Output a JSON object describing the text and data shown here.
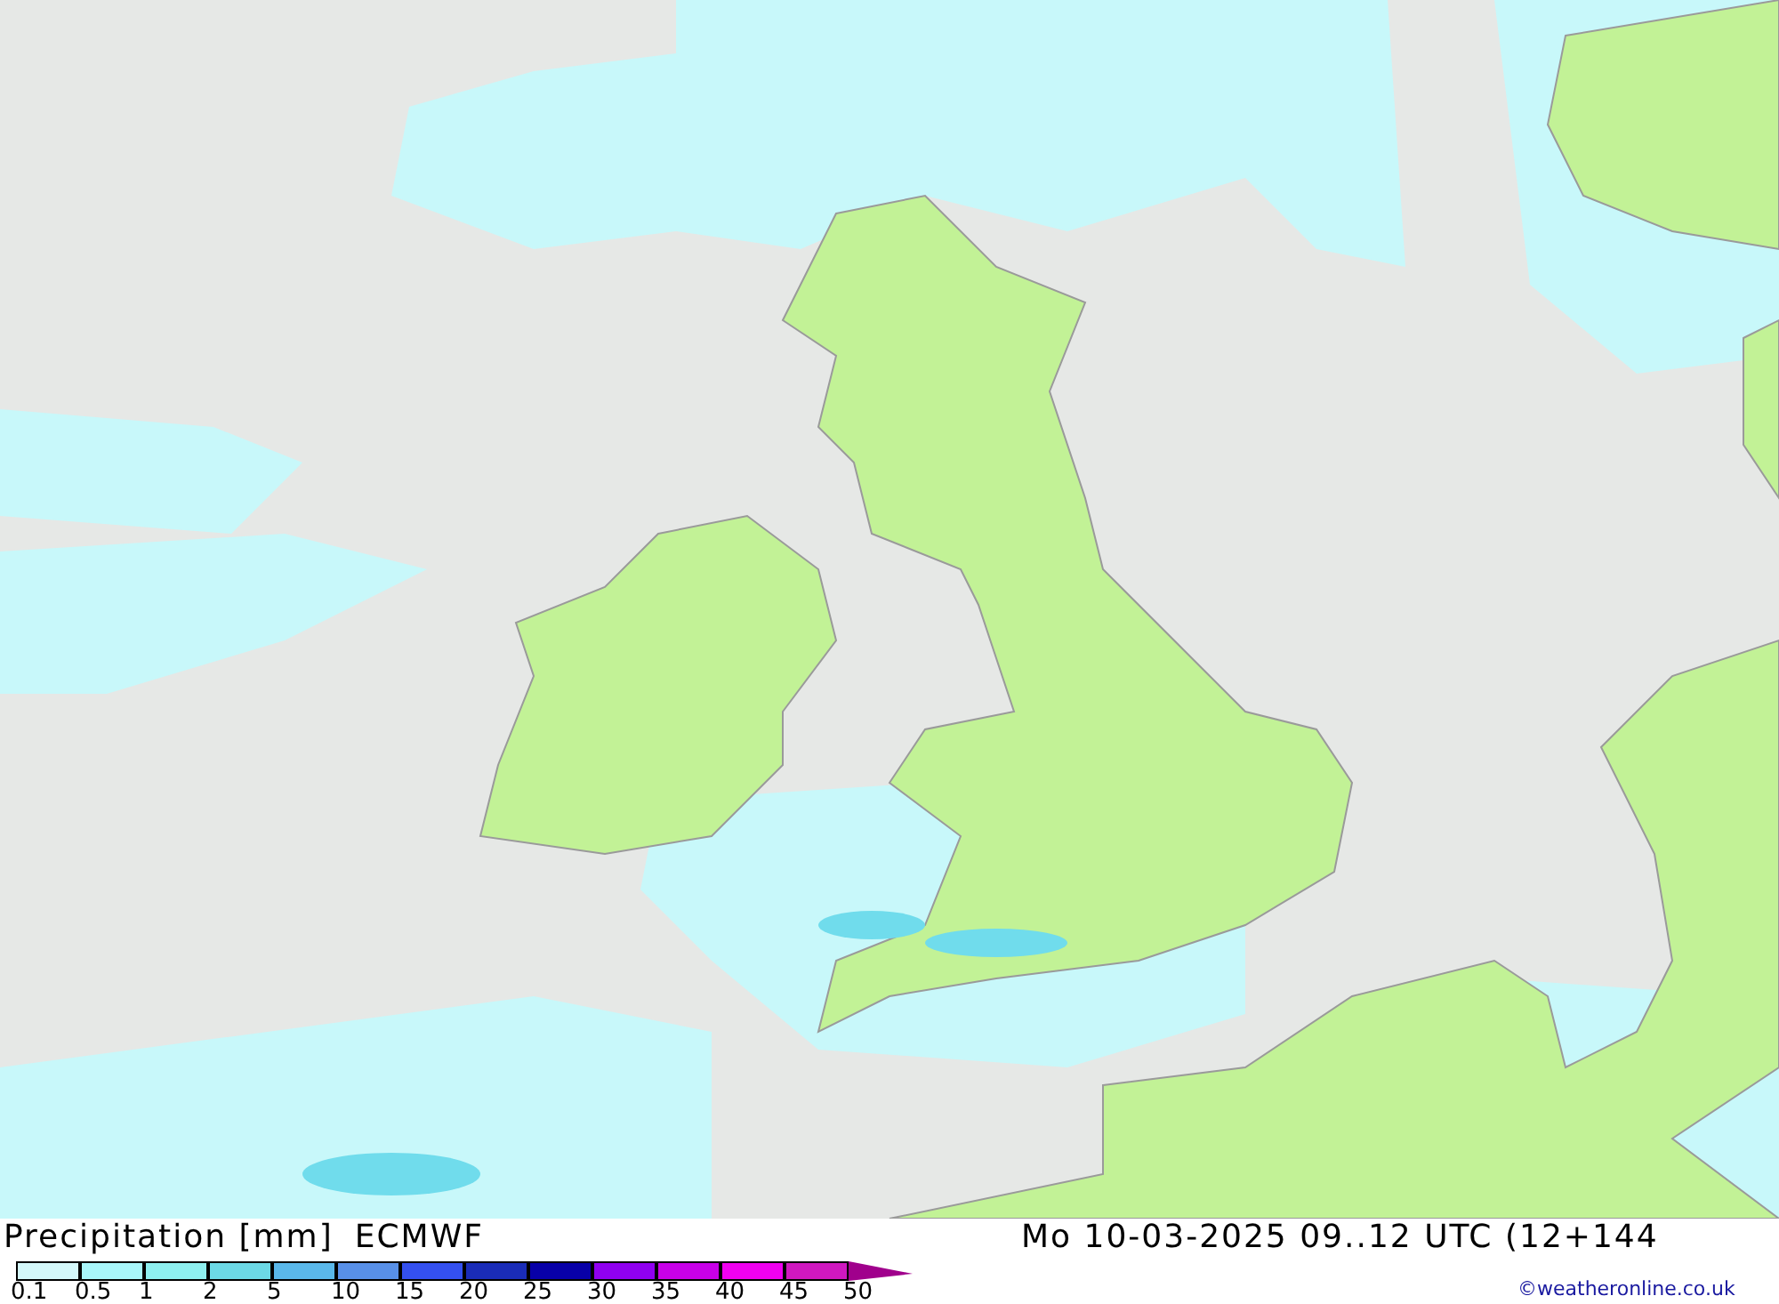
{
  "map": {
    "title": "Precipitation [mm]",
    "model": "ECMWF",
    "valid_time": "Mo 10-03-2025 09..12 UTC (12+144"
  },
  "legend": [
    {
      "label": "0.1",
      "color": "#d4f8fa"
    },
    {
      "label": "0.5",
      "color": "#a8f6fa"
    },
    {
      "label": "1",
      "color": "#8ef0f0"
    },
    {
      "label": "2",
      "color": "#6cd9e6"
    },
    {
      "label": "5",
      "color": "#5ab8ea"
    },
    {
      "label": "10",
      "color": "#5890e8"
    },
    {
      "label": "15",
      "color": "#3450f0"
    },
    {
      "label": "20",
      "color": "#1a2cb8"
    },
    {
      "label": "25",
      "color": "#0800a8"
    },
    {
      "label": "30",
      "color": "#9000f0"
    },
    {
      "label": "35",
      "color": "#c800e8"
    },
    {
      "label": "40",
      "color": "#f000f0"
    },
    {
      "label": "45",
      "color": "#d018c0"
    },
    {
      "label": "50",
      "color": "#a0008c"
    }
  ],
  "credit": "©weatheronline.co.uk"
}
